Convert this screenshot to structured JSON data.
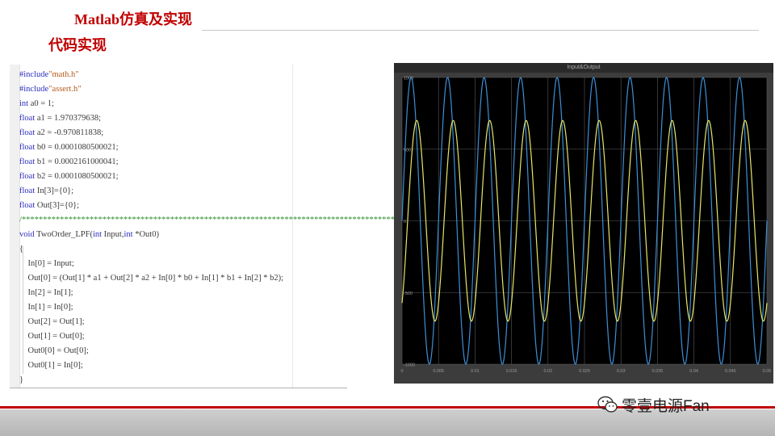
{
  "slide": {
    "title": "Matlab仿真及实现",
    "subtitle": "代码实现"
  },
  "code": {
    "lines": [
      "#include\"math.h\"",
      "#include\"assert.h\"",
      "int a0 = 1;",
      "float a1 = 1.970379638;",
      "float a2 = -0.970811838;",
      "float b0 = 0.0001080500021;",
      "float b1 = 0.0002161000041;",
      "float b2 = 0.0001080500021;",
      "float In[3]={0};",
      "float Out[3]={0};",
      "/****************************************************************************************/",
      "void TwoOrder_LPF(int Input,int *Out0)",
      "{",
      "    In[0] = Input;",
      "    Out[0] = (Out[1] * a1 + Out[2] * a2 + In[0] * b0 + In[1] * b1 + In[2] * b2);",
      "    In[2] = In[1];",
      "    In[1] = In[0];",
      "    Out[2] = Out[1];",
      "    Out[1] = Out[0];",
      "    Out0[0] = Out[0];",
      "    Out0[1] = In[0];",
      "}"
    ]
  },
  "scope": {
    "title": "Input&Output",
    "y_ticks": [
      "1000",
      "500",
      "0",
      "-500",
      "-1000"
    ],
    "x_ticks": [
      "0",
      "0.005",
      "0.01",
      "0.015",
      "0.02",
      "0.025",
      "0.03",
      "0.035",
      "0.04",
      "0.045",
      "0.05"
    ],
    "colors": {
      "input": "#3e8fd6",
      "output": "#e6e66a",
      "background": "#000000",
      "grid": "#5a5a5a"
    }
  },
  "chart_data": {
    "type": "line",
    "title": "Input&Output",
    "xlim": [
      0,
      0.05
    ],
    "ylim": [
      -1000,
      1000
    ],
    "grid": true,
    "series": [
      {
        "amplitude": 1000,
        "frequency_hz": 200,
        "phase": 0
      },
      {
        "amplitude": 700,
        "frequency_hz": 200,
        "phase_lag_deg": 55
      }
    ]
  },
  "watermark": {
    "text": "零壹电源Fan",
    "icon": "wechat-icon"
  }
}
